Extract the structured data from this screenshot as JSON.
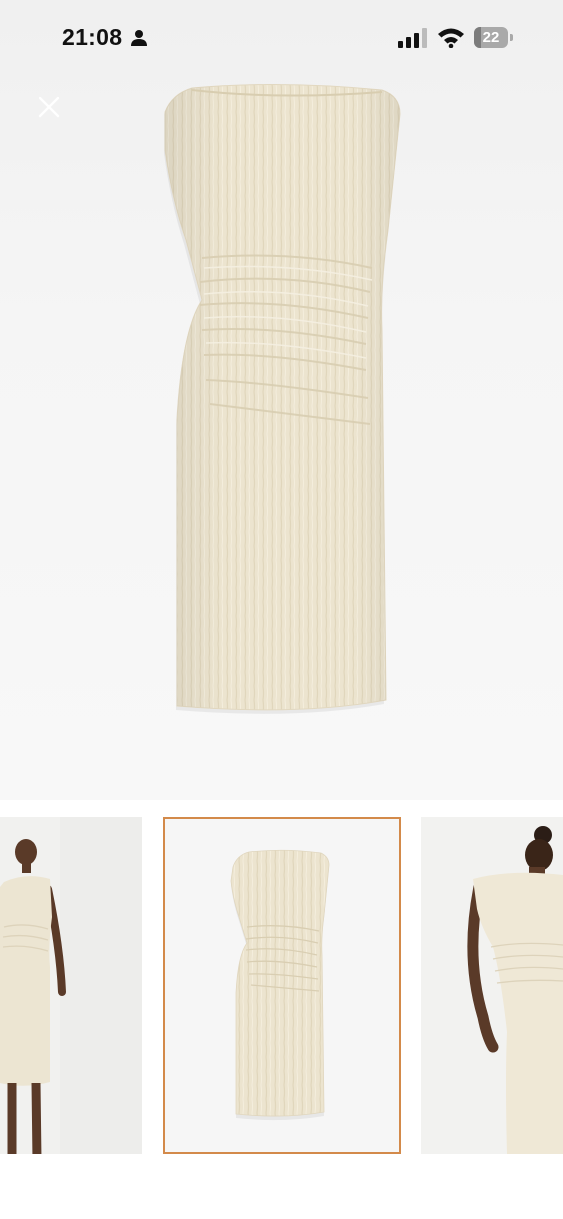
{
  "status_bar": {
    "time": "21:08",
    "battery_level": "22",
    "battery_fraction": 0.22,
    "icons": [
      "person-icon",
      "signal-icon",
      "wifi-icon",
      "battery-icon"
    ]
  },
  "viewer": {
    "close_icon": "close-icon",
    "main_image": "dress-front-flat-image",
    "dress_color": "#ede5d0"
  },
  "thumbnails": {
    "selected_index": 1,
    "selected_border_color": "#d38a4a",
    "items": [
      {
        "image": "model-front-image"
      },
      {
        "image": "dress-flat-image"
      },
      {
        "image": "model-back-image"
      }
    ]
  }
}
